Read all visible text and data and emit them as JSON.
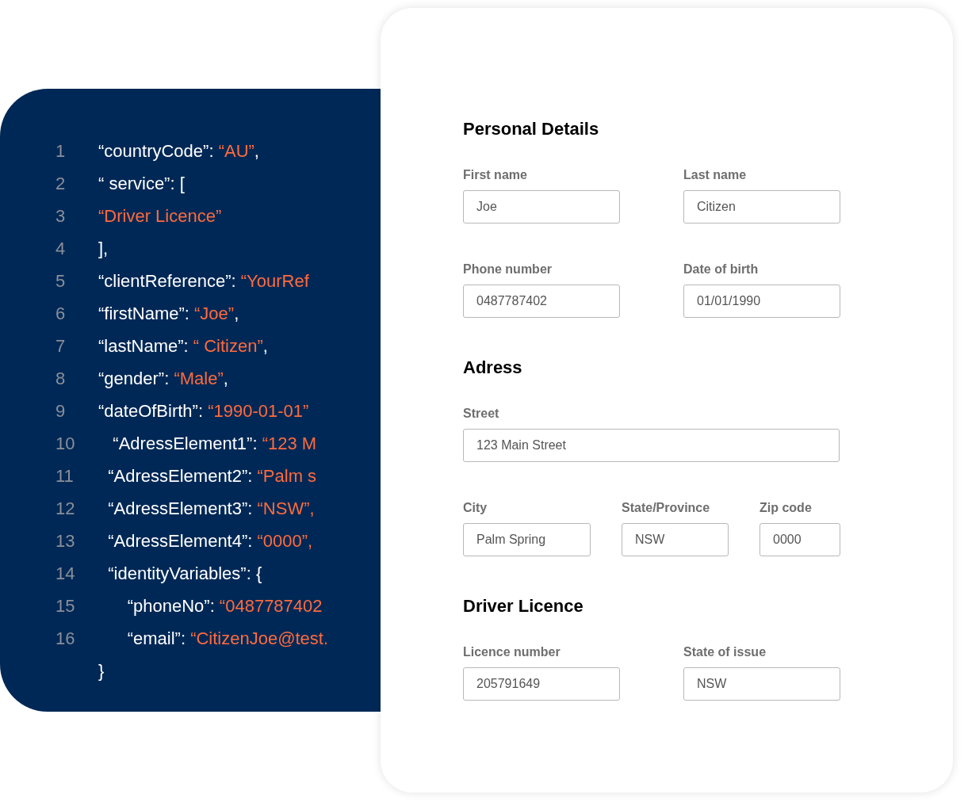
{
  "code_panel": {
    "lines": [
      {
        "number": "1",
        "tokens": [
          {
            "kind": "key",
            "text": "“countryCode”: "
          },
          {
            "kind": "value",
            "text": "“AU”"
          },
          {
            "kind": "key",
            "text": ","
          }
        ]
      },
      {
        "number": "2",
        "tokens": [
          {
            "kind": "key",
            "text": "“ service”: ["
          }
        ]
      },
      {
        "number": "3",
        "tokens": [
          {
            "kind": "value",
            "text": "“Driver Licence”"
          }
        ]
      },
      {
        "number": "4",
        "tokens": [
          {
            "kind": "key",
            "text": "],"
          }
        ]
      },
      {
        "number": "5",
        "tokens": [
          {
            "kind": "key",
            "text": "“clientReference”: "
          },
          {
            "kind": "value",
            "text": "“YourRef"
          }
        ]
      },
      {
        "number": "6",
        "tokens": [
          {
            "kind": "key",
            "text": "“firstName”: "
          },
          {
            "kind": "value",
            "text": "“Joe”"
          },
          {
            "kind": "key",
            "text": ","
          }
        ]
      },
      {
        "number": "7",
        "tokens": [
          {
            "kind": "key",
            "text": "“lastName”: "
          },
          {
            "kind": "value",
            "text": "“ Citizen”"
          },
          {
            "kind": "key",
            "text": ","
          }
        ]
      },
      {
        "number": "8",
        "tokens": [
          {
            "kind": "key",
            "text": "“gender”: "
          },
          {
            "kind": "value",
            "text": "“Male”"
          },
          {
            "kind": "key",
            "text": ","
          }
        ]
      },
      {
        "number": "9",
        "tokens": [
          {
            "kind": "key",
            "text": "“dateOfBirth”: "
          },
          {
            "kind": "value",
            "text": "“1990-01-01”"
          }
        ]
      },
      {
        "number": "10",
        "tokens": [
          {
            "kind": "key",
            "text": "   “AdressElement1”: "
          },
          {
            "kind": "value",
            "text": "“123 M"
          }
        ]
      },
      {
        "number": "11",
        "tokens": [
          {
            "kind": "key",
            "text": "  “AdressElement2”: "
          },
          {
            "kind": "value",
            "text": "“Palm s"
          }
        ]
      },
      {
        "number": "12",
        "tokens": [
          {
            "kind": "key",
            "text": "  “AdressElement3”: "
          },
          {
            "kind": "value",
            "text": "“NSW”,"
          }
        ]
      },
      {
        "number": "13",
        "tokens": [
          {
            "kind": "key",
            "text": "  “AdressElement4”: "
          },
          {
            "kind": "value",
            "text": "“0000”,"
          }
        ]
      },
      {
        "number": "14",
        "tokens": [
          {
            "kind": "key",
            "text": "  “identityVariables”: {"
          }
        ]
      },
      {
        "number": "15",
        "tokens": [
          {
            "kind": "key",
            "text": "      “phoneNo”: "
          },
          {
            "kind": "value",
            "text": "“0487787402"
          }
        ]
      },
      {
        "number": "16",
        "tokens": [
          {
            "kind": "key",
            "text": "      “email”: "
          },
          {
            "kind": "value",
            "text": "“CitizenJoe@test."
          }
        ]
      },
      {
        "tokens": [
          {
            "kind": "key",
            "text": "}"
          }
        ]
      }
    ]
  },
  "form": {
    "sections": [
      {
        "title": "Personal Details",
        "rows": [
          {
            "fields": [
              {
                "label": "First name",
                "value": "Joe"
              },
              {
                "label": "Last name",
                "value": "Citizen"
              }
            ]
          },
          {
            "fields": [
              {
                "label": "Phone number",
                "value": "0487787402"
              },
              {
                "label": "Date of birth",
                "value": "01/01/1990"
              }
            ]
          }
        ]
      },
      {
        "title": "Adress",
        "rows": [
          {
            "fields": [
              {
                "label": "Street",
                "value": "123 Main Street"
              }
            ]
          },
          {
            "fields": [
              {
                "label": "City",
                "value": "Palm Spring"
              },
              {
                "label": "State/Province",
                "value": "NSW"
              },
              {
                "label": "Zip code",
                "value": "0000"
              }
            ]
          }
        ]
      },
      {
        "title": "Driver Licence",
        "rows": [
          {
            "fields": [
              {
                "label": "Licence number",
                "value": "205791649"
              },
              {
                "label": "State of issue",
                "value": "NSW"
              }
            ]
          }
        ]
      }
    ]
  }
}
